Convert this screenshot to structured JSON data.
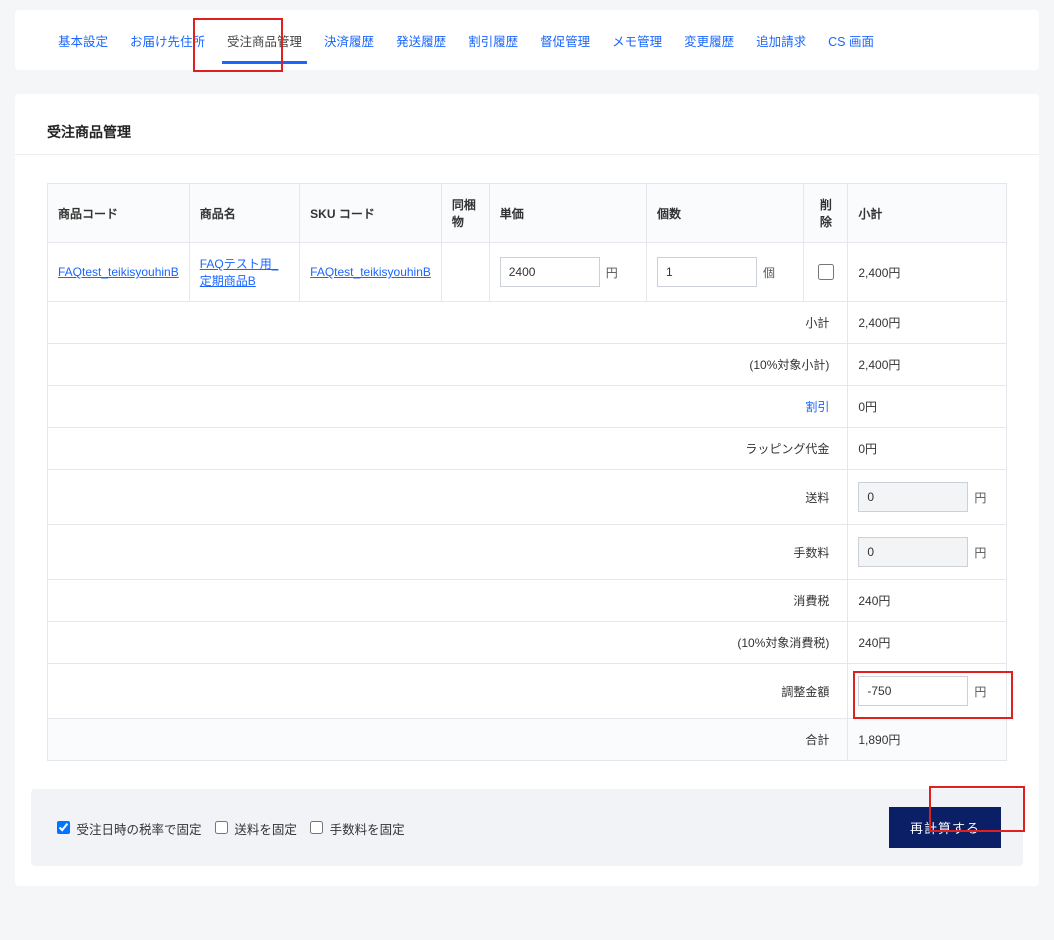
{
  "tabs": {
    "items": [
      {
        "label": "基本設定"
      },
      {
        "label": "お届け先住所"
      },
      {
        "label": "受注商品管理"
      },
      {
        "label": "決済履歴"
      },
      {
        "label": "発送履歴"
      },
      {
        "label": "割引履歴"
      },
      {
        "label": "督促管理"
      },
      {
        "label": "メモ管理"
      },
      {
        "label": "変更履歴"
      },
      {
        "label": "追加請求"
      },
      {
        "label": "CS 画面"
      }
    ],
    "active_index": 2
  },
  "section_title": "受注商品管理",
  "table": {
    "headers": {
      "code": "商品コード",
      "name": "商品名",
      "sku": "SKU コード",
      "bundle": "同梱物",
      "unit_price": "単価",
      "qty": "個数",
      "delete": "削除",
      "subtotal": "小計"
    },
    "row": {
      "code": "FAQtest_teikisyouhinB",
      "name": "FAQテスト用_定期商品B",
      "sku": "FAQtest_teikisyouhinB",
      "bundle": "",
      "unit_price_value": "2400",
      "unit_price_unit": "円",
      "qty_value": "1",
      "qty_unit": "個",
      "delete_checked": false,
      "subtotal": "2,400円"
    }
  },
  "summary": {
    "subtotal": {
      "label": "小計",
      "value": "2,400円"
    },
    "tax10_sub": {
      "label": "(10%対象小計)",
      "value": "2,400円"
    },
    "discount": {
      "label": "割引",
      "value": "0円"
    },
    "wrapping": {
      "label": "ラッピング代金",
      "value": "0円"
    },
    "shipping": {
      "label": "送料",
      "value": "0",
      "unit": "円"
    },
    "fee": {
      "label": "手数料",
      "value": "0",
      "unit": "円"
    },
    "tax": {
      "label": "消費税",
      "value": "240円"
    },
    "tax10": {
      "label": "(10%対象消費税)",
      "value": "240円"
    },
    "adjust": {
      "label": "調整金額",
      "value": "-750",
      "unit": "円"
    },
    "total": {
      "label": "合計",
      "value": "1,890円"
    }
  },
  "footer": {
    "fix_tax_rate": "受注日時の税率で固定",
    "fix_shipping": "送料を固定",
    "fix_fee": "手数料を固定",
    "recalc_btn": "再計算する"
  }
}
